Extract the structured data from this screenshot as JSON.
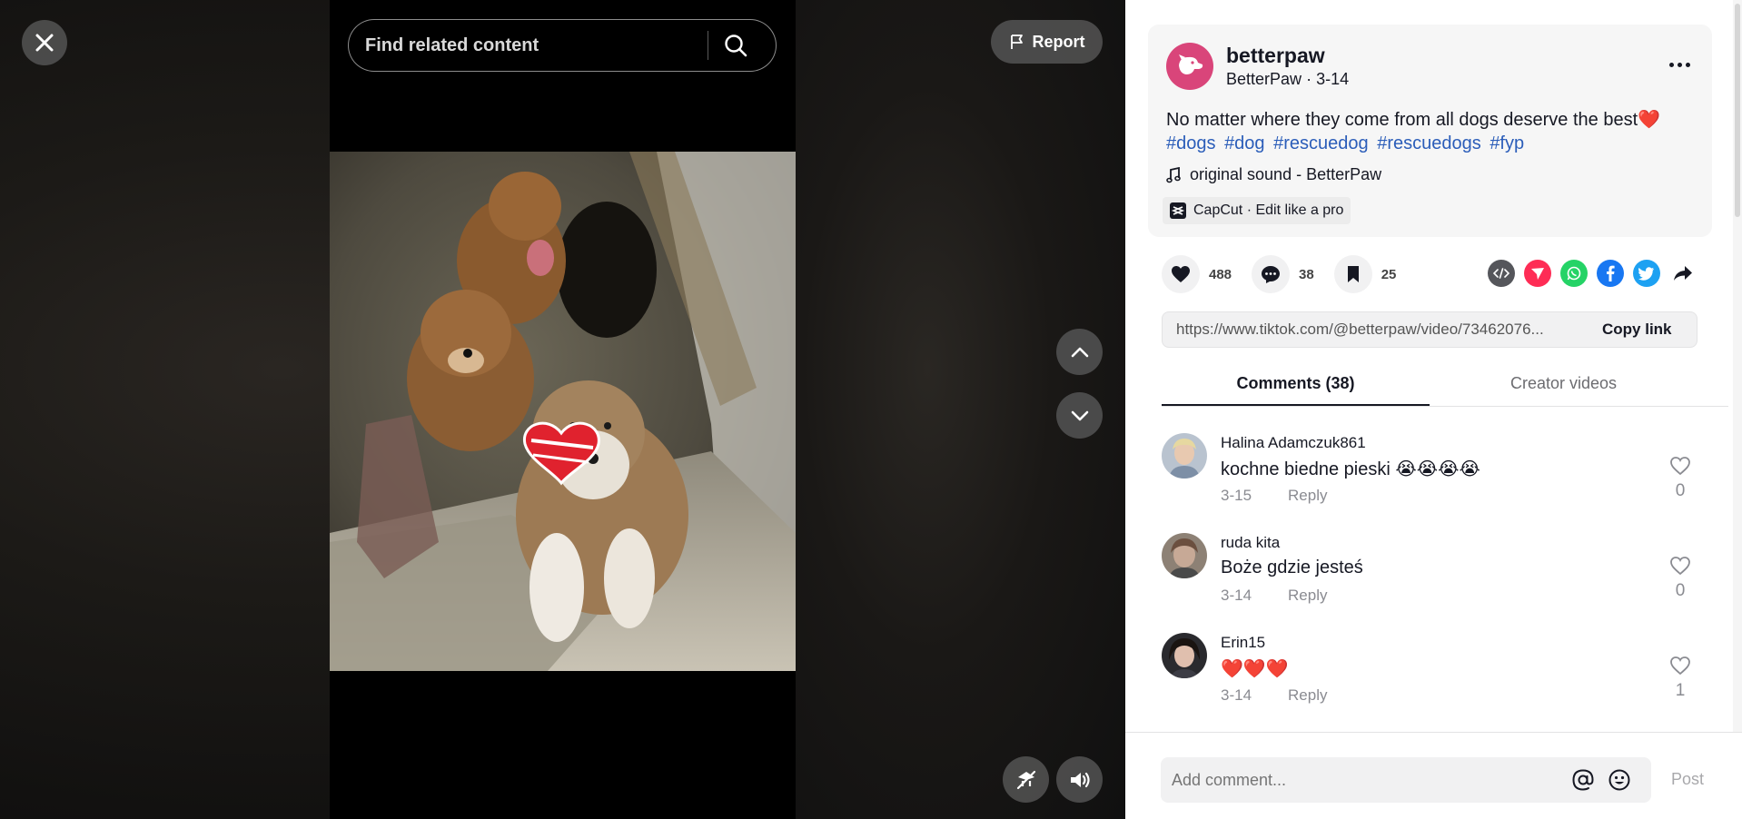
{
  "player": {
    "search": {
      "placeholder": "Find related content"
    },
    "report_label": "Report"
  },
  "post": {
    "handle": "betterpaw",
    "display_name": "BetterPaw",
    "date": "3-14",
    "caption": "No matter where they come from all dogs deserve the best❤️",
    "hashtags": [
      "#dogs",
      "#dog",
      "#rescuedog",
      "#rescuedogs",
      "#fyp"
    ],
    "music": "original sound - BetterPaw",
    "capcut": "CapCut · Edit like a pro",
    "stats": {
      "likes": "488",
      "comments": "38",
      "saves": "25"
    },
    "link": "https://www.tiktok.com/@betterpaw/video/73462076...",
    "copy_link_label": "Copy link"
  },
  "tabs": {
    "comments": "Comments (38)",
    "creator_videos": "Creator videos"
  },
  "comments": [
    {
      "name": "Halina Adamczuk861",
      "text": "kochne biedne pieski 😭😭😭😭",
      "date": "3-15",
      "reply": "Reply",
      "likes": "0"
    },
    {
      "name": "ruda kita",
      "text": "Boże gdzie jesteś",
      "date": "3-14",
      "reply": "Reply",
      "likes": "0"
    },
    {
      "name": "Erin15",
      "text": "❤️❤️❤️",
      "date": "3-14",
      "reply": "Reply",
      "likes": "1"
    }
  ],
  "comment_bar": {
    "placeholder": "Add comment...",
    "post_label": "Post"
  },
  "colors": {
    "brand_avatar": "#d9457a",
    "hashtag": "#2b5db9",
    "facebook": "#1877f2",
    "twitter": "#1da1f2",
    "whatsapp": "#25d366",
    "red_share": "#fe2c55"
  }
}
